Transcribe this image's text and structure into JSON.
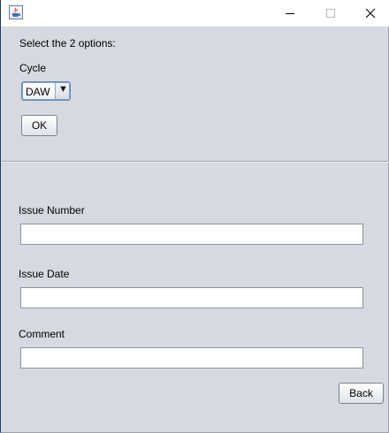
{
  "window": {
    "title": "",
    "controls": {
      "minimize_icon": "minimize-icon",
      "maximize_icon": "maximize-icon",
      "close_icon": "close-icon"
    }
  },
  "options": {
    "prompt": "Select the 2 options:",
    "cycle_label": "Cycle",
    "cycle_selected": "DAW",
    "ok_label": "OK"
  },
  "issue": {
    "number_label": "Issue Number",
    "number_value": "",
    "date_label": "Issue Date",
    "date_value": "",
    "comment_label": "Comment",
    "comment_value": ""
  },
  "footer": {
    "back_label": "Back"
  },
  "colors": {
    "window_bg": "#d6d9df",
    "titlebar_bg": "#ffffff",
    "focus_border": "#7aa3d8"
  }
}
